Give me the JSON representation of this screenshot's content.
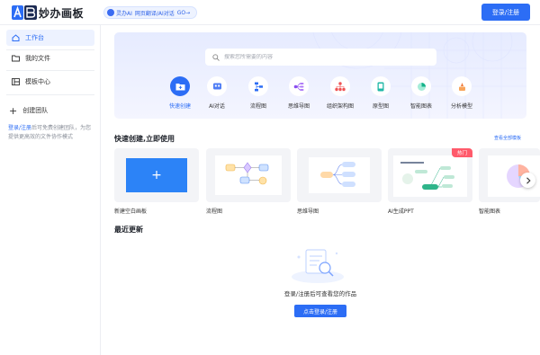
{
  "header": {
    "logo_text": "妙办画板",
    "ai_pill": [
      "灵办AI",
      "网页翻译/AI对话",
      "GO→"
    ],
    "login_button": "登录/注册"
  },
  "sidebar": {
    "items": [
      {
        "label": "工作台",
        "icon": "home-icon",
        "active": true
      },
      {
        "label": "我的文件",
        "icon": "folder-icon"
      },
      {
        "label": "模板中心",
        "icon": "template-icon"
      }
    ],
    "create_team": "创建团队",
    "note_link": "登录/注册",
    "note_rest": "后可免费创建团队，为您提供更高效的文件协作模式"
  },
  "search": {
    "placeholder": "搜索您所需要的内容"
  },
  "tools": [
    {
      "label": "快速创建",
      "icon": "folder-create-icon",
      "active": true
    },
    {
      "label": "AI对话",
      "icon": "ai-chat-icon"
    },
    {
      "label": "流程图",
      "icon": "flowchart-icon"
    },
    {
      "label": "思维导图",
      "icon": "mindmap-icon"
    },
    {
      "label": "组织架构图",
      "icon": "org-chart-icon"
    },
    {
      "label": "原型图",
      "icon": "prototype-icon"
    },
    {
      "label": "智能图表",
      "icon": "smart-chart-icon"
    },
    {
      "label": "分析模型",
      "icon": "analysis-model-icon"
    }
  ],
  "quick": {
    "title": "快速创建,立即使用",
    "see_all": "查看全部模板",
    "cards": [
      "新建空白画板",
      "流程图",
      "思维导图",
      "AI生成PPT",
      "智能图表"
    ],
    "hot_badge": "热门"
  },
  "recent": {
    "title": "最近更新",
    "empty_text": "登录/注册后可查看您的作品",
    "empty_button": "点击登录/注册"
  },
  "colors": {
    "accent": "#2c6df5",
    "hot": "#ff5a6b"
  }
}
